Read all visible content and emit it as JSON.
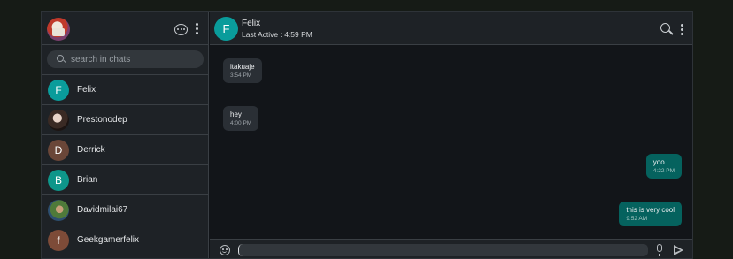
{
  "sidebar": {
    "search": {
      "placeholder": "search in chats"
    },
    "contacts": [
      {
        "name": "Felix",
        "initial": "F",
        "avatar_color": "#0a9c9b"
      },
      {
        "name": "Prestonodep",
        "initial": "",
        "avatar": "photo"
      },
      {
        "name": "Derrick",
        "initial": "D",
        "avatar_color": "#6a4638"
      },
      {
        "name": "Brian",
        "initial": "B",
        "avatar_color": "#0e968a"
      },
      {
        "name": "Davidmilai67",
        "initial": "",
        "avatar": "photo"
      },
      {
        "name": "Geekgamerfelix",
        "initial": "f",
        "avatar_color": "#7d4b38"
      }
    ]
  },
  "chat": {
    "contact": {
      "initial": "F",
      "name": "Felix",
      "status": "Last Active : 4:59 PM"
    },
    "messages": [
      {
        "direction": "incoming",
        "text": "itakuaje",
        "time": "3:54 PM"
      },
      {
        "direction": "incoming",
        "text": "hey",
        "time": "4:00 PM"
      },
      {
        "direction": "outgoing",
        "text": "yoo",
        "time": "4:22 PM"
      },
      {
        "direction": "outgoing",
        "text": "this is very cool",
        "time": "9:52 AM"
      }
    ],
    "composer": {
      "value": ""
    }
  },
  "icons": {
    "new_chat": "chat-bubble-icon",
    "menu": "kebab-menu-icon",
    "search": "search-icon",
    "emoji": "emoji-icon",
    "mic": "microphone-icon",
    "send": "send-icon"
  },
  "colors": {
    "accent": "#0a9c9b",
    "outgoing_bubble": "#05625e",
    "incoming_bubble": "#2a2f35",
    "panel": "#1e2226",
    "background": "#121519"
  }
}
